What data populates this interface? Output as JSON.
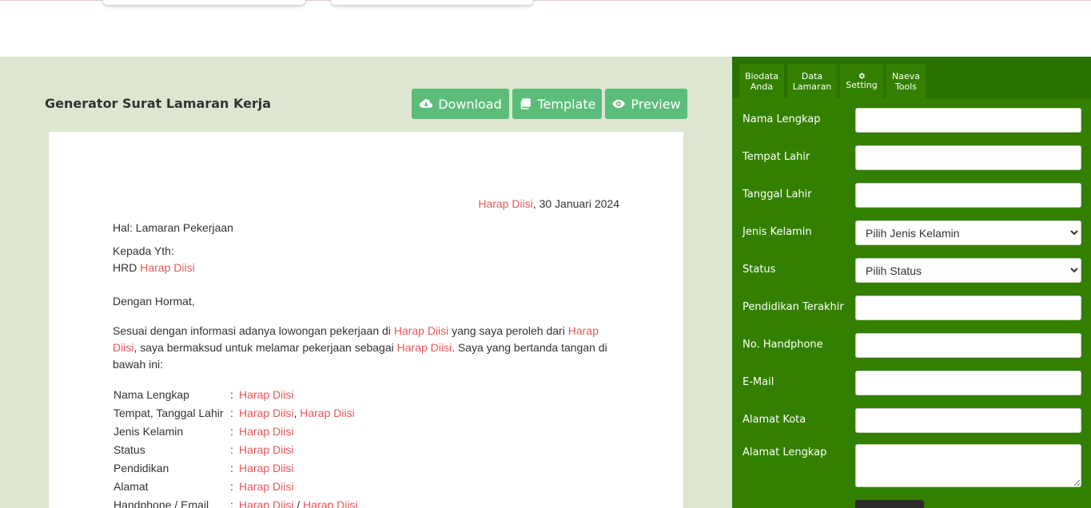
{
  "main": {
    "title": "Generator Surat Lamaran Kerja",
    "buttons": {
      "download": "Download",
      "template": "Template",
      "preview": "Preview"
    }
  },
  "letter": {
    "placeholder": "Harap Diisi",
    "date_suffix": ", 30 Januari 2024",
    "subject": "Hal: Lamaran Pekerjaan",
    "to_line1": "Kepada Yth:",
    "to_line2_prefix": "HRD ",
    "greeting": "Dengan Hormat,",
    "body_1": "Sesuai dengan informasi adanya lowongan pekerjaan di ",
    "body_2": " yang saya peroleh dari ",
    "body_3": ", saya bermaksud untuk melamar pekerjaan sebagai ",
    "body_4": ". Saya yang bertanda tangan di bawah ini:",
    "colon": ":",
    "comma": ", ",
    "slash": " / ",
    "rows": [
      "Nama Lengkap",
      "Tempat, Tanggal Lahir",
      "Jenis Kelamin",
      "Status",
      "Pendidikan",
      "Alamat",
      "Handphone / Email"
    ]
  },
  "sidebar": {
    "tabs": [
      {
        "line1": "Biodata",
        "line2": "Anda"
      },
      {
        "line1": "Data",
        "line2": "Lamaran"
      },
      {
        "line1": "",
        "line2": "Setting"
      },
      {
        "line1": "Naeva",
        "line2": "Tools"
      }
    ],
    "fields": {
      "nama": "Nama Lengkap",
      "tempat": "Tempat Lahir",
      "tanggal": "Tanggal Lahir",
      "jk": "Jenis Kelamin",
      "jk_select": "Pilih Jenis Kelamin",
      "status": "Status",
      "status_select": "Pilih Status",
      "pendidikan": "Pendidikan Terakhir",
      "hp": "No. Handphone",
      "email": "E-Mail",
      "kota": "Alamat Kota",
      "alamat": "Alamat Lengkap"
    }
  },
  "colors": {
    "accent": "#5cbd7a",
    "sidebar": "#338000",
    "placeholder": "#e8575a",
    "bg": "#dde6d0"
  },
  "icons": {
    "download": "cloud-download-icon",
    "template": "clone-icon",
    "preview": "eye-icon",
    "setting": "gear-icon"
  }
}
